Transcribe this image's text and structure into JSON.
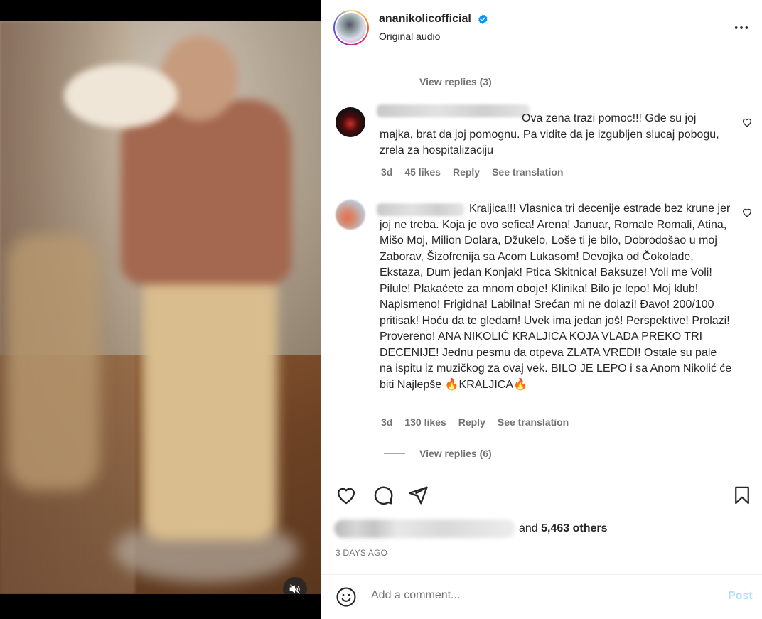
{
  "header": {
    "username": "ananikolicofficial",
    "subtitle": "Original audio",
    "verified_icon": "verified-badge-icon",
    "more_icon": "more-options-icon"
  },
  "media": {
    "mute_icon": "speaker-muted-icon"
  },
  "comments": {
    "view_replies_top": "View replies (3)",
    "items": [
      {
        "text": "Ova zena trazi pomoc!!! Gde su joj majka, brat da joj pomognu. Pa vidite da je izgubljen slucaj pobogu, zrela za hospitalizaciju",
        "time": "3d",
        "likes": "45 likes",
        "reply": "Reply",
        "translate": "See translation"
      },
      {
        "text": "Kraljica!!! Vlasnica tri decenije estrade bez krune jer joj ne treba. Koja je ovo sefica! Arena! Januar, Romale Romali, Atina, Mišo Moj, Milion Dolara, Džukelo, Loše ti je bilo, Dobrodošao u moj Zaborav, Šizofrenija sa Acom Lukasom! Devojka od Čokolade, Ekstaza, Dum jedan Konjak! Ptica Skitnica! Baksuze! Voli me Voli! Pilule! Plakaćete za mnom oboje! Klinika! Bilo je lepo! Moj klub! Napismeno! Frigidna! Labilna! Srećan mi ne dolazi! Đavo! 200/100 pritisak! Hoću da te gledam! Uvek ima jedan još! Perspektive! Prolazi! Provereno! ANA NIKOLIĆ KRALJICA KOJA VLADA PREKO TRI DECENIJE! Jednu pesmu da otpeva ZLATA VREDI! Ostale su pale na ispitu iz muzičkog za ovaj vek. BILO JE LEPO i sa Anom Nikolić će biti Najlepše 🔥KRALJICA🔥",
        "time": "3d",
        "likes": "130 likes",
        "reply": "Reply",
        "translate": "See translation"
      }
    ],
    "view_replies_bottom": "View replies (6)"
  },
  "actions": {
    "likes_prefix": "and",
    "likes_count": "5,463 others",
    "timestamp": "3 DAYS AGO"
  },
  "add_comment": {
    "placeholder": "Add a comment...",
    "post_label": "Post"
  },
  "colors": {
    "link_disabled": "#b2dffc",
    "secondary_text": "#737373",
    "verified_blue": "#0095f6"
  }
}
